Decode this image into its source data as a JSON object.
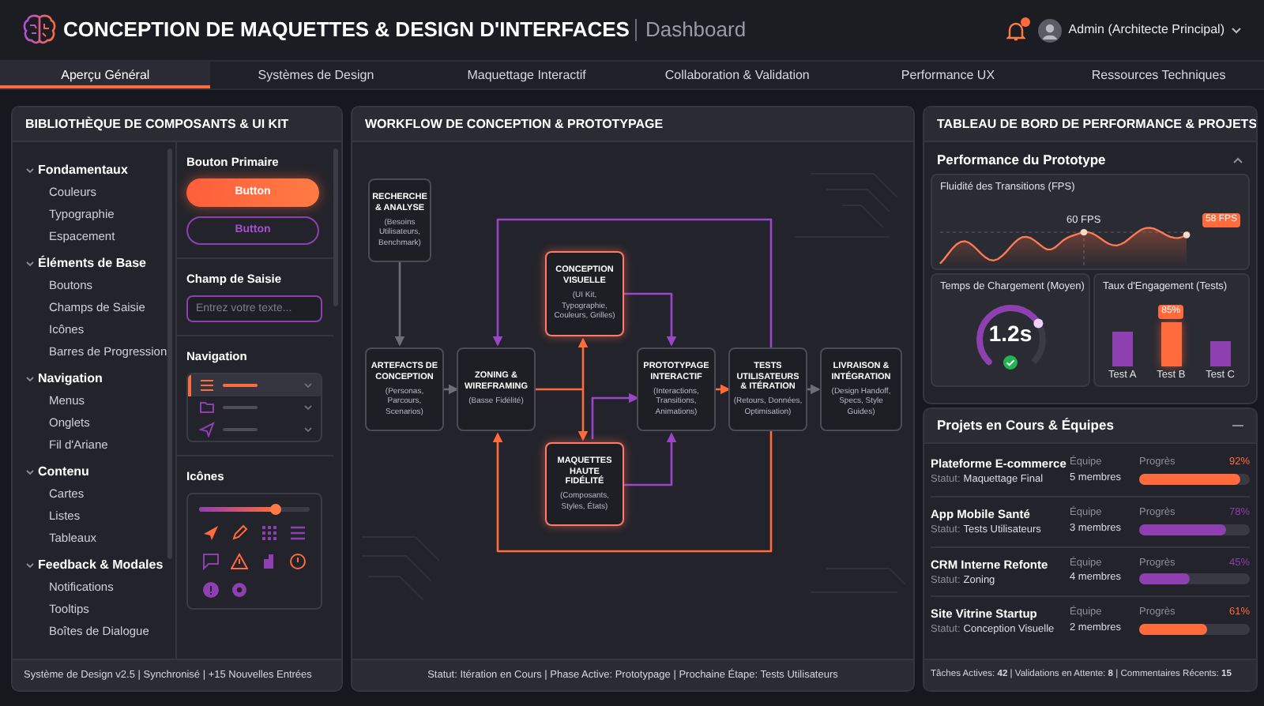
{
  "header": {
    "title": "CONCEPTION DE MAQUETTES & DESIGN D'INTERFACES",
    "subtitle": "Dashboard",
    "notification": true,
    "user": "Admin (Architecte Principal)"
  },
  "tabs": [
    {
      "label": "Aperçu Général",
      "selected": true
    },
    {
      "label": "Systèmes de Design",
      "selected": false
    },
    {
      "label": "Maquettage Interactif",
      "selected": false
    },
    {
      "label": "Collaboration & Validation",
      "selected": false
    },
    {
      "label": "Performance UX",
      "selected": false
    },
    {
      "label": "Ressources Techniques",
      "selected": false
    }
  ],
  "library": {
    "title": "BIBLIOTHÈQUE DE COMPOSANTS & UI KIT",
    "tree": [
      {
        "label": "Fondamentaux",
        "expanded": true,
        "children": [
          {
            "label": "Couleurs"
          },
          {
            "label": "Typographie"
          },
          {
            "label": "Espacement"
          }
        ]
      },
      {
        "label": "Éléments de Base",
        "expanded": true,
        "children": [
          {
            "label": "Boutons"
          },
          {
            "label": "Champs de Saisie"
          },
          {
            "label": "Icônes"
          },
          {
            "label": "Barres de Progression"
          }
        ]
      },
      {
        "label": "Navigation",
        "expanded": true,
        "children": [
          {
            "label": "Menus"
          },
          {
            "label": "Onglets"
          },
          {
            "label": "Fil d'Ariane"
          }
        ]
      },
      {
        "label": "Contenu",
        "expanded": true,
        "children": [
          {
            "label": "Cartes"
          },
          {
            "label": "Listes"
          },
          {
            "label": "Tableaux"
          }
        ]
      },
      {
        "label": "Feedback & Modales",
        "expanded": true,
        "children": [
          {
            "label": "Notifications"
          },
          {
            "label": "Tooltips"
          },
          {
            "label": "Boîtes de Dialogue"
          }
        ]
      }
    ],
    "showcase": {
      "buttons": {
        "title": "Bouton Primaire",
        "items": [
          {
            "label": "Button",
            "kind": "filled"
          },
          {
            "label": "Button",
            "kind": "outline"
          }
        ]
      },
      "input": {
        "title": "Champ de Saisie",
        "placeholder": "Entrez votre texte..."
      },
      "navigation": {
        "title": "Navigation",
        "items": [
          {
            "kind": "menu",
            "selected": true
          },
          {
            "kind": "folder",
            "selected": false
          },
          {
            "kind": "send",
            "selected": false
          }
        ]
      },
      "icons": {
        "title": "Icônes",
        "slider": {
          "level": 0.68
        }
      }
    },
    "footer": "Système de Design v2.5 | Synchronisé | +15 Nouvelles Entrées"
  },
  "workflow": {
    "title": "WORKFLOW DE CONCEPTION & PROTOTYPAGE",
    "nodes": [
      {
        "title": "RECHERCHE & ANALYSE",
        "detail": "(Besoins Utilisateurs, Benchmark)",
        "highlighted": false
      },
      {
        "title": "ARTEFACTS DE CONCEPTION",
        "detail": "(Personas, Parcours, Scenarios)",
        "highlighted": false
      },
      {
        "title": "ZONING & WIREFRAMING",
        "detail": "(Basse Fidélité)",
        "highlighted": false
      },
      {
        "title": "CONCEPTION VISUELLE",
        "detail": "(UI Kit, Typographie, Couleurs, Grilles)",
        "highlighted": true
      },
      {
        "title": "PROTOTYPAGE INTERACTIF",
        "detail": "(Interactions, Transitions, Animations)",
        "highlighted": false
      },
      {
        "title": "TESTS UTILISATEURS & ITÉRATION",
        "detail": "(Retours, Données, Optimisation)",
        "highlighted": false
      },
      {
        "title": "LIVRAISON & INTÉGRATION",
        "detail": "(Design Handoff, Specs, Style Guides)",
        "highlighted": false
      },
      {
        "title": "MAQUETTES HAUTE FIDÉLITÉ",
        "detail": "(Composants, Styles, États)",
        "highlighted": true
      }
    ],
    "status": "Statut: Itération en Cours | Phase Active: Prototypage | Prochaine Étape: Tests Utilisateurs"
  },
  "dashboard": {
    "title": "TABLEAU DE BORD DE PERFORMANCE & PROJETS",
    "performance": {
      "title": "Performance du Prototype",
      "fps": {
        "title": "Fluidité des Transitions (FPS)",
        "peak_label": "60 FPS",
        "current_label": "58 FPS"
      },
      "load_time": {
        "title": "Temps de Chargement (Moyen)",
        "value": "1.2s",
        "level": 0.72
      },
      "engagement": {
        "title": "Taux d'Engagement (Tests)",
        "highlight": "85%",
        "bars": [
          {
            "label": "Test A",
            "selected": false
          },
          {
            "label": "Test B",
            "selected": true
          },
          {
            "label": "Test C",
            "selected": false
          }
        ]
      }
    }
  },
  "projects": {
    "title": "Projets en Cours & Équipes",
    "rows": [
      {
        "name": "Plateforme E-commerce",
        "status_label": "Statut:",
        "status": "Maquettage Final",
        "team_label": "Équipe",
        "team": "5 membres",
        "progress_label": "Progrès",
        "percent": "92%",
        "level": 0.92,
        "color": "#ff6b3d"
      },
      {
        "name": "App Mobile Santé",
        "status_label": "Statut:",
        "status": "Tests Utilisateurs",
        "team_label": "Équipe",
        "team": "3 membres",
        "progress_label": "Progrès",
        "percent": "78%",
        "level": 0.78,
        "color": "#8e3fb0"
      },
      {
        "name": "CRM Interne Refonte",
        "status_label": "Statut:",
        "status": "Zoning",
        "team_label": "Équipe",
        "team": "4 membres",
        "progress_label": "Progrès",
        "percent": "45%",
        "level": 0.45,
        "color": "#8e3fb0"
      },
      {
        "name": "Site Vitrine Startup",
        "status_label": "Statut:",
        "status": "Conception Visuelle",
        "team_label": "Équipe",
        "team": "2 membres",
        "progress_label": "Progrès",
        "percent": "61%",
        "level": 0.61,
        "color": "#ff6b3d"
      }
    ],
    "footer": "Tâches Actives: **42** | Validations en Attente: **8** | Commentaires Récents: **15**"
  }
}
